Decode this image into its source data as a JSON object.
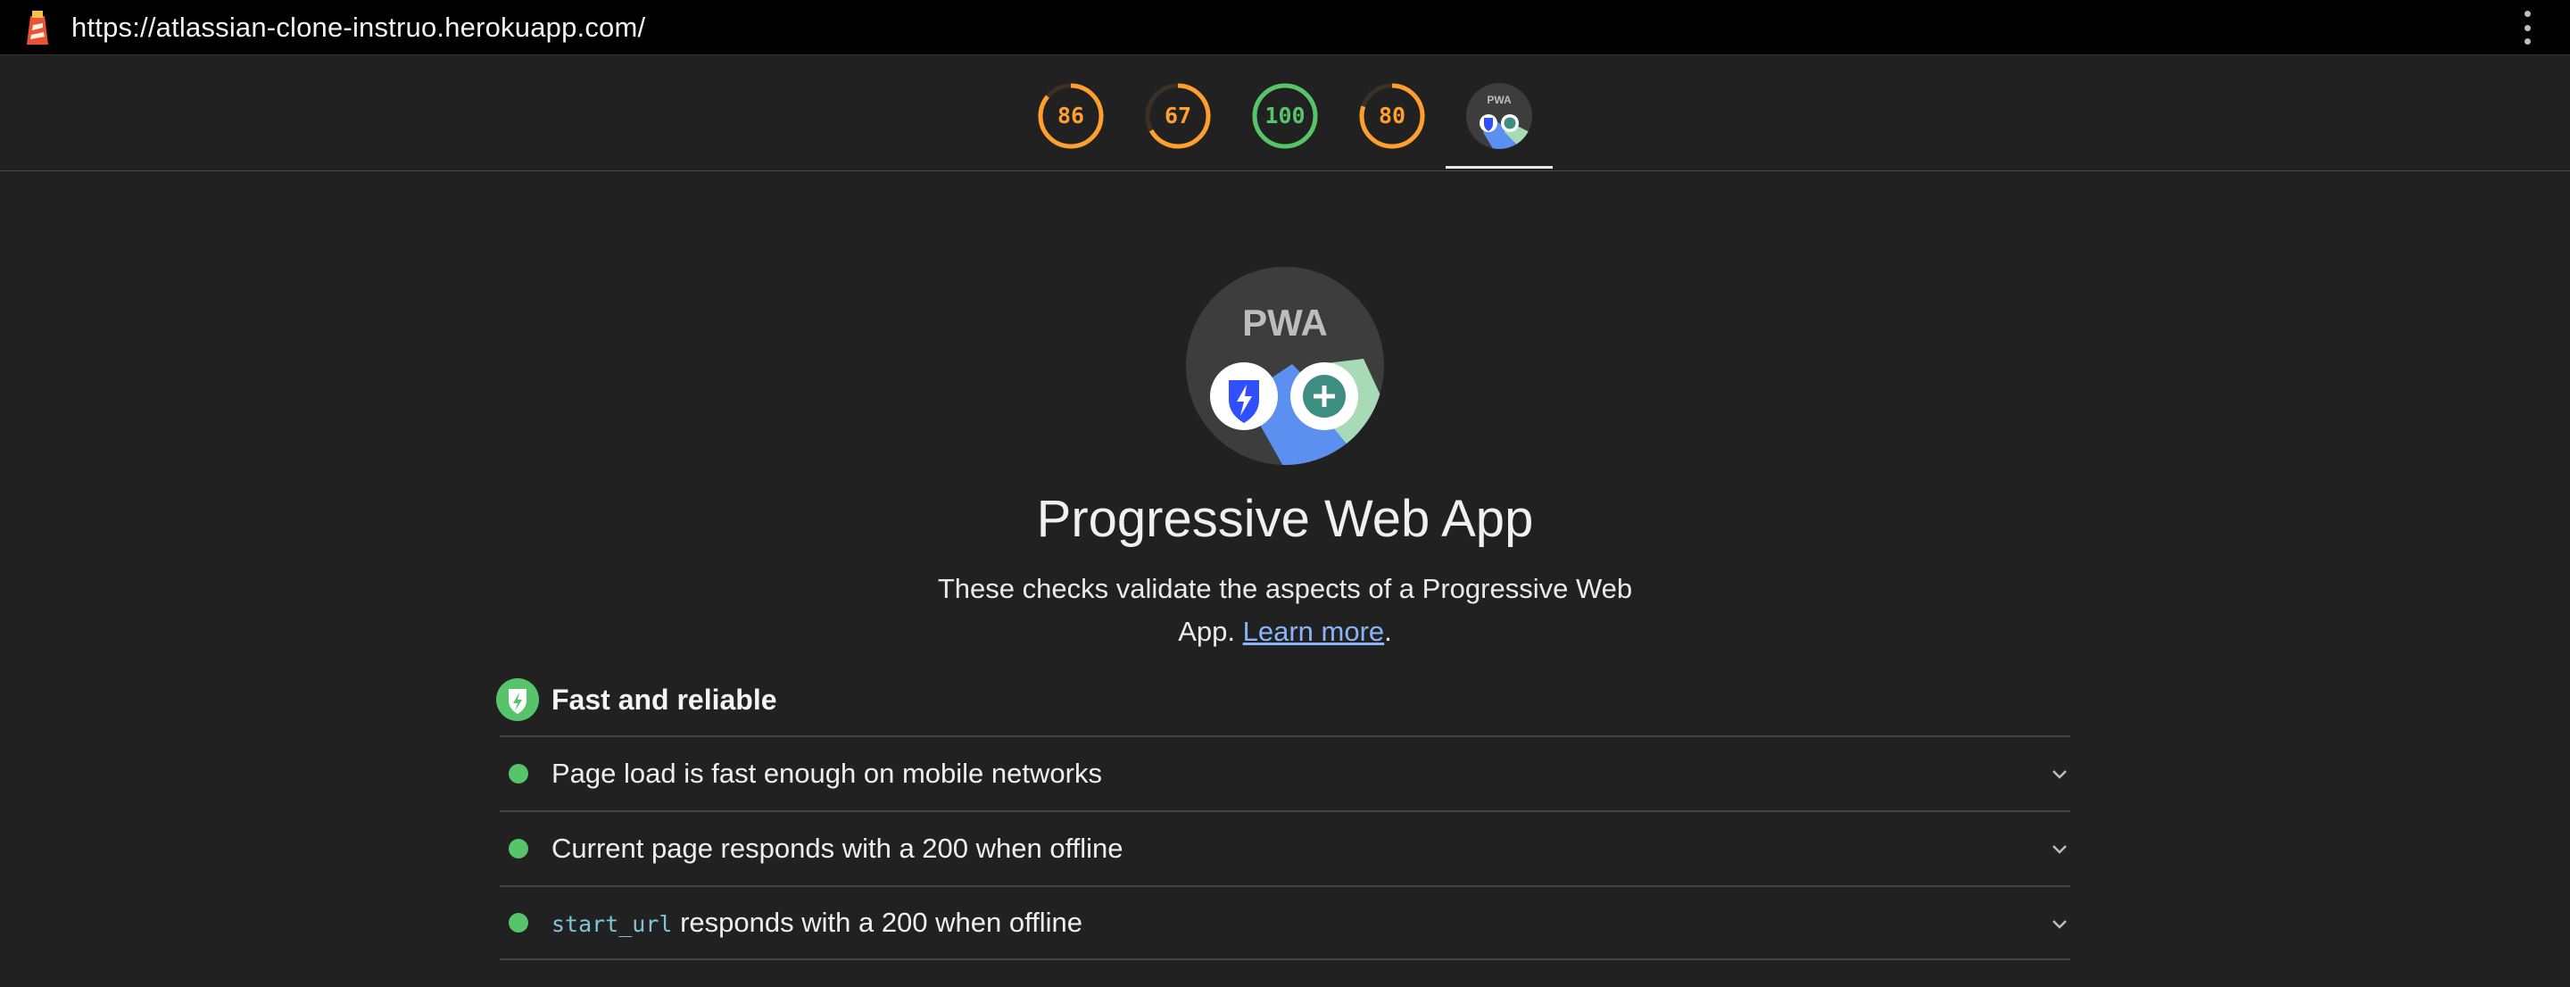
{
  "browser": {
    "url": "https://atlassian-clone-instruo.herokuapp.com/"
  },
  "scores": [
    {
      "name": "gauge-performance",
      "value": "86",
      "fraction": 0.86,
      "color": "#ff9f2e"
    },
    {
      "name": "gauge-accessibility",
      "value": "67",
      "fraction": 0.67,
      "color": "#ff9f2e"
    },
    {
      "name": "gauge-best-practices",
      "value": "100",
      "fraction": 1.0,
      "color": "#57c46b"
    },
    {
      "name": "gauge-seo",
      "value": "80",
      "fraction": 0.8,
      "color": "#ff9f2e"
    }
  ],
  "category": {
    "badge_label": "PWA",
    "title": "Progressive Web App",
    "description": "These checks validate the aspects of a Progressive Web App.",
    "learn_more": "Learn more",
    "period": "."
  },
  "group": {
    "title": "Fast and reliable"
  },
  "audits": [
    {
      "code": "",
      "label": "Page load is fast enough on mobile networks"
    },
    {
      "code": "",
      "label": "Current page responds with a 200 when offline"
    },
    {
      "code": "start_url",
      "label": " responds with a 200 when offline"
    }
  ],
  "colors": {
    "pass": "#57c46b",
    "average": "#ff9f2e",
    "link": "#8ab4f8",
    "background": "#212121"
  }
}
